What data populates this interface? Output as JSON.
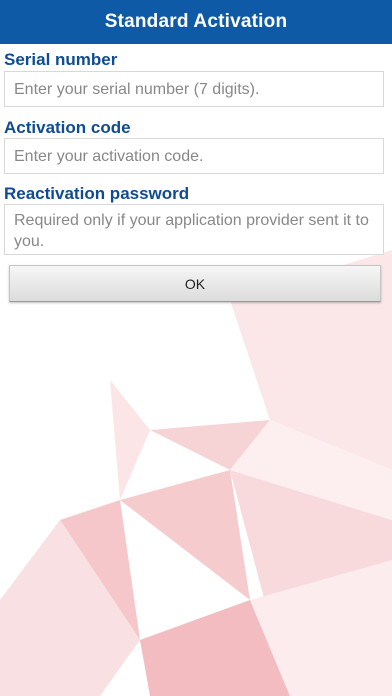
{
  "header": {
    "title": "Standard Activation"
  },
  "form": {
    "serial_label": "Serial number",
    "serial_placeholder": "Enter your serial number (7 digits).",
    "activation_label": "Activation code",
    "activation_placeholder": "Enter your activation code.",
    "reactivation_label": "Reactivation password",
    "reactivation_placeholder": "Required only if your application provider sent it to you.",
    "ok_label": "OK"
  },
  "colors": {
    "header_bg": "#0f5aa6",
    "label_text": "#0f4c92",
    "accent_background": "#f3c6c8"
  }
}
